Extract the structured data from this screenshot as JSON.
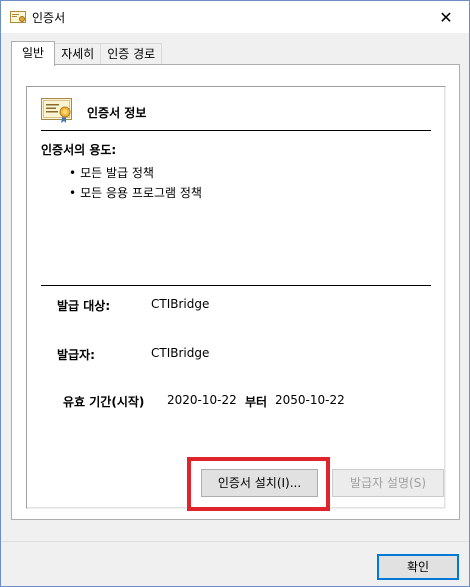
{
  "window": {
    "title": "인증서",
    "close_glyph": "✕"
  },
  "tabs": [
    {
      "label": "일반",
      "active": true
    },
    {
      "label": "자세히",
      "active": false
    },
    {
      "label": "인증 경로",
      "active": false
    }
  ],
  "general": {
    "heading": "인증서 정보",
    "purpose_title": "인증서의 용도:",
    "purposes": [
      "모든 발급 정책",
      "모든 응용 프로그램 정책"
    ],
    "issued_to_label": "발급 대상:",
    "issued_to_value": "CTIBridge",
    "issued_by_label": "발급자:",
    "issued_by_value": "CTIBridge",
    "validity_label": "유효 기간(시작)",
    "valid_from": "2020-10-22",
    "until_label": "부터",
    "valid_to": "2050-10-22"
  },
  "buttons": {
    "install": "인증서 설치(I)...",
    "issuer_statement": "발급자 설명(S)",
    "ok": "확인"
  },
  "colors": {
    "highlight": "#e0242b",
    "accent": "#0078d7"
  },
  "icons": {
    "title": "certificate-icon",
    "cert": "certificate-icon",
    "close": "close-icon"
  }
}
